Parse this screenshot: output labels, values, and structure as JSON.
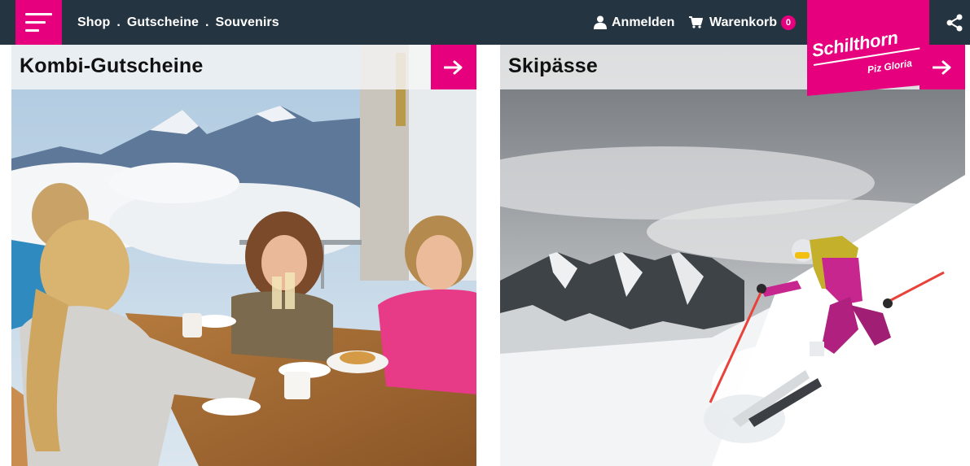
{
  "nav": {
    "menu_label": "Menü",
    "links": [
      {
        "label": "Shop"
      },
      {
        "label": "Gutscheine"
      },
      {
        "label": "Souvenirs"
      }
    ],
    "separator": "."
  },
  "account": {
    "login_label": "Anmelden"
  },
  "cart": {
    "label": "Warenkorb",
    "count": "0"
  },
  "brand": {
    "name": "Schilthorn",
    "subtitle": "Piz Gloria"
  },
  "cards": [
    {
      "title": "Kombi-Gutscheine",
      "image": "restaurant-friends-eiger-view"
    },
    {
      "title": "Skipässe",
      "image": "freeride-skier-alps"
    }
  ],
  "colors": {
    "accent": "#e6007e",
    "topbar": "#243440",
    "card_header": "#f5f5f5"
  },
  "icons": [
    "menu-icon",
    "user-icon",
    "cart-icon",
    "share-icon",
    "arrow-right-icon"
  ]
}
